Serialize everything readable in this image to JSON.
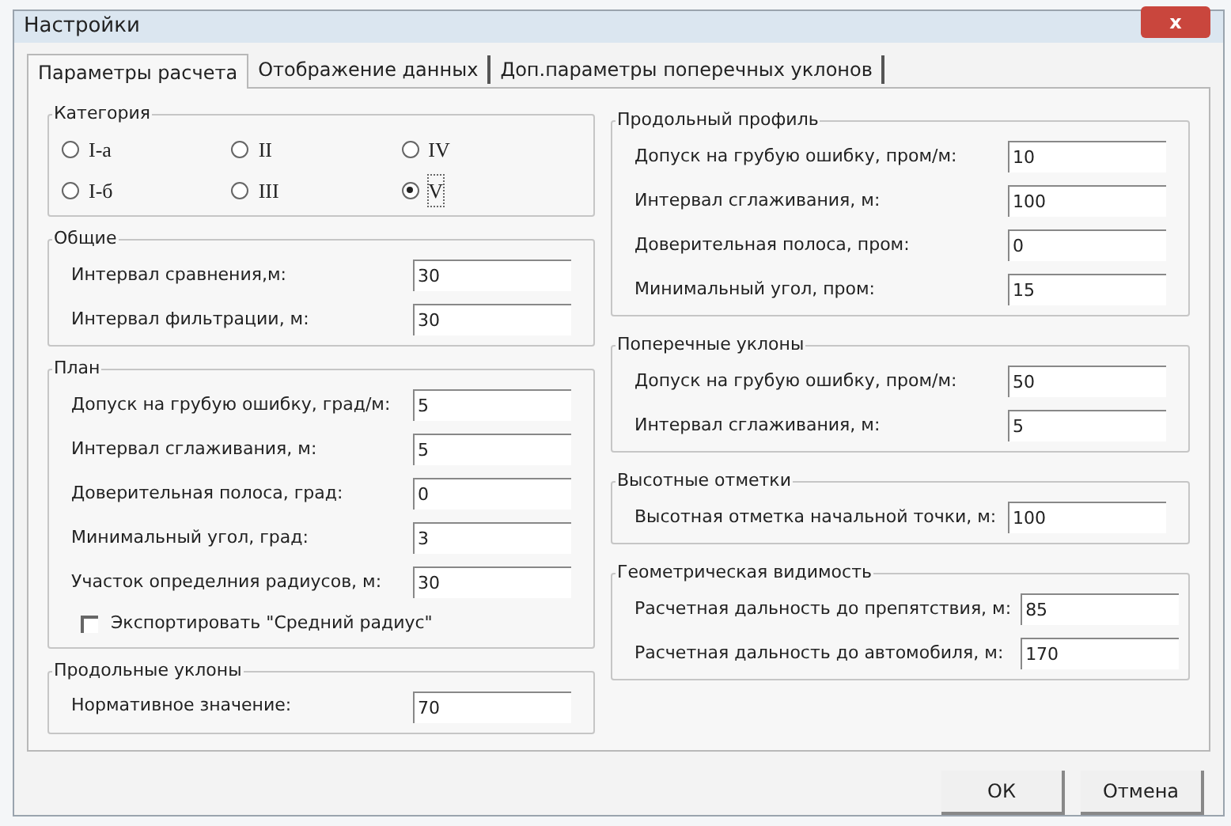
{
  "window": {
    "title": "Настройки",
    "close": "x"
  },
  "tabs": [
    {
      "label": "Параметры расчета",
      "selected": true
    },
    {
      "label": "Отображение данных",
      "selected": false
    },
    {
      "label": "Доп.параметры поперечных уклонов",
      "selected": false
    }
  ],
  "left": [
    {
      "kind": "radios",
      "title": "Категория",
      "options": [
        {
          "label": "I-а",
          "selected": false
        },
        {
          "label": "II",
          "selected": false
        },
        {
          "label": "IV",
          "selected": false
        },
        {
          "label": "I-б",
          "selected": false
        },
        {
          "label": "III",
          "selected": false
        },
        {
          "label": "V",
          "selected": true
        }
      ]
    },
    {
      "kind": "fields",
      "title": "Общие",
      "fields": [
        {
          "label": "Интервал сравнения,м:",
          "value": "30"
        },
        {
          "label": "Интервал фильтрации, м:",
          "value": "30"
        }
      ]
    },
    {
      "kind": "fields",
      "title": "План",
      "fields": [
        {
          "label": "Допуск на грубую ошибку, град/м:",
          "value": "5"
        },
        {
          "label": "Интервал сглаживания, м:",
          "value": "5"
        },
        {
          "label": "Доверительная полоса, град:",
          "value": "0"
        },
        {
          "label": "Минимальный угол, град:",
          "value": "3"
        },
        {
          "label": "Участок определния радиусов, м:",
          "value": "30"
        }
      ],
      "checkbox": {
        "label": "Экспортировать \"Средний радиус\"",
        "checked": false
      }
    },
    {
      "kind": "fields",
      "title": "Продольные уклоны",
      "fields": [
        {
          "label": "Нормативное значение:",
          "value": "70"
        }
      ]
    }
  ],
  "right": [
    {
      "kind": "fields",
      "title": "Продольный профиль",
      "fields": [
        {
          "label": "Допуск на грубую ошибку, пром/м:",
          "value": "10"
        },
        {
          "label": "Интервал сглаживания, м:",
          "value": "100"
        },
        {
          "label": "Доверительная полоса, пром:",
          "value": "0"
        },
        {
          "label": "Минимальный угол, пром:",
          "value": "15"
        }
      ]
    },
    {
      "kind": "fields",
      "title": "Поперечные уклоны",
      "fields": [
        {
          "label": "Допуск на грубую ошибку, пром/м:",
          "value": "50"
        },
        {
          "label": "Интервал сглаживания, м:",
          "value": "5"
        }
      ]
    },
    {
      "kind": "fields",
      "title": "Высотные отметки",
      "fields": [
        {
          "label": "Высотная отметка начальной точки, м:",
          "value": "100"
        }
      ]
    },
    {
      "kind": "fields",
      "title": "Геометрическая видимость",
      "fields": [
        {
          "label": "Расчетная дальность до препятствия, м:",
          "value": "85"
        },
        {
          "label": "Расчетная дальность до автомобиля, м:",
          "value": "170"
        }
      ]
    }
  ],
  "buttons": [
    "ОК",
    "Отмена"
  ]
}
